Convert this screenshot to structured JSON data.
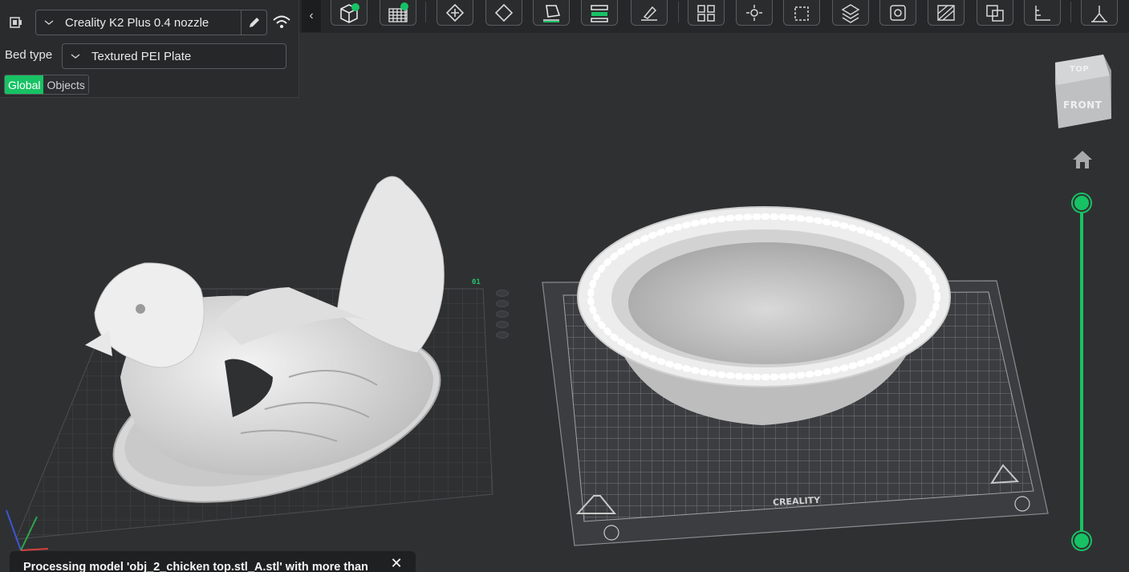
{
  "printer": {
    "name": "Creality K2 Plus 0.4 nozzle"
  },
  "bed": {
    "label": "Bed type",
    "value": "Textured PEI Plate"
  },
  "mode_toggle": {
    "global": "Global",
    "objects": "Objects",
    "active": "Global"
  },
  "toolbar": {
    "collapse_glyph": "‹",
    "icons": [
      "add-object-icon",
      "add-plate-icon",
      "auto-orient-icon",
      "arrange-icon",
      "lay-on-face-icon",
      "split-objects-icon",
      "variable-layer-icon",
      "cut-icon",
      "support-paint-icon",
      "seam-paint-icon",
      "scale-icon",
      "measure-icon",
      "hollow-icon",
      "color-paint-icon",
      "boolean-icon",
      "assembly-icon",
      "text-icon"
    ]
  },
  "view_cube": {
    "top": "TOP",
    "front": "FRONT"
  },
  "plate": {
    "number": "01",
    "brand": "CREALITY"
  },
  "notification": {
    "text": "Processing model 'obj_2_chicken top.stl_A.stl' with more than",
    "close_glyph": "✕"
  },
  "colors": {
    "accent": "#17c264",
    "background": "#2f3032",
    "panel": "#2a2b2d"
  },
  "layer_slider": {
    "top_position": 1.0,
    "bottom_position": 0.0
  }
}
